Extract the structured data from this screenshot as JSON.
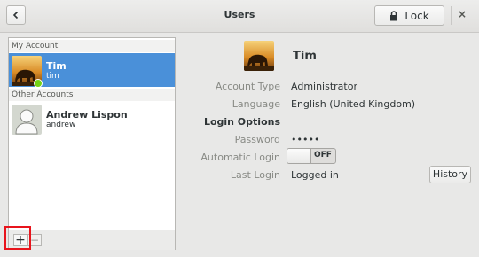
{
  "window": {
    "title": "Users",
    "lock_label": "Lock",
    "close_glyph": "×"
  },
  "sidebar": {
    "my_account_label": "My Account",
    "other_accounts_label": "Other Accounts",
    "accounts": [
      {
        "name": "Tim",
        "username": "tim",
        "selected": true,
        "online": true,
        "avatar": "elephant-sunset-photo"
      },
      {
        "name": "Andrew Lispon",
        "username": "andrew",
        "selected": false,
        "online": false,
        "avatar": "default-user-silhouette"
      }
    ],
    "add_glyph": "+",
    "remove_glyph": "−"
  },
  "details": {
    "name": "Tim",
    "account_type_label": "Account Type",
    "account_type_value": "Administrator",
    "language_label": "Language",
    "language_value": "English (United Kingdom)",
    "login_options_label": "Login Options",
    "password_label": "Password",
    "password_value": "•••••",
    "automatic_login_label": "Automatic Login",
    "automatic_login_state": "OFF",
    "last_login_label": "Last Login",
    "last_login_value": "Logged in",
    "history_label": "History"
  },
  "colors": {
    "selection": "#4a90d9",
    "online_dot": "#73d216",
    "highlight_box": "#e8141c"
  }
}
